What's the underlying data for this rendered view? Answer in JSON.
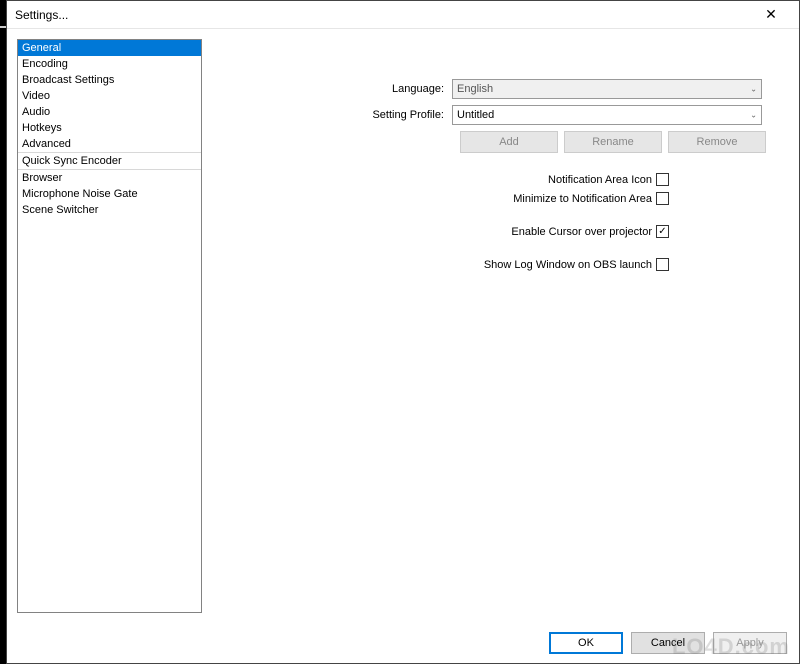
{
  "window": {
    "title": "Settings..."
  },
  "sidebar": {
    "items": [
      {
        "label": "General",
        "selected": true
      },
      {
        "label": "Encoding"
      },
      {
        "label": "Broadcast Settings"
      },
      {
        "label": "Video"
      },
      {
        "label": "Audio"
      },
      {
        "label": "Hotkeys"
      },
      {
        "label": "Advanced"
      },
      {
        "label": "Quick Sync Encoder",
        "sep_before": true,
        "sep_after": true
      },
      {
        "label": "Browser"
      },
      {
        "label": "Microphone Noise Gate"
      },
      {
        "label": "Scene Switcher"
      }
    ]
  },
  "form": {
    "language_label": "Language:",
    "language_value": "English",
    "profile_label": "Setting Profile:",
    "profile_value": "Untitled",
    "add_label": "Add",
    "rename_label": "Rename",
    "remove_label": "Remove"
  },
  "checks": {
    "notification_icon_label": "Notification Area Icon",
    "notification_icon_checked": false,
    "minimize_label": "Minimize to Notification Area",
    "minimize_checked": false,
    "cursor_label": "Enable Cursor over projector",
    "cursor_checked": true,
    "log_label": "Show Log Window on OBS launch",
    "log_checked": false
  },
  "footer": {
    "ok_label": "OK",
    "cancel_label": "Cancel",
    "apply_label": "Apply"
  },
  "watermark": "LO4D.com"
}
